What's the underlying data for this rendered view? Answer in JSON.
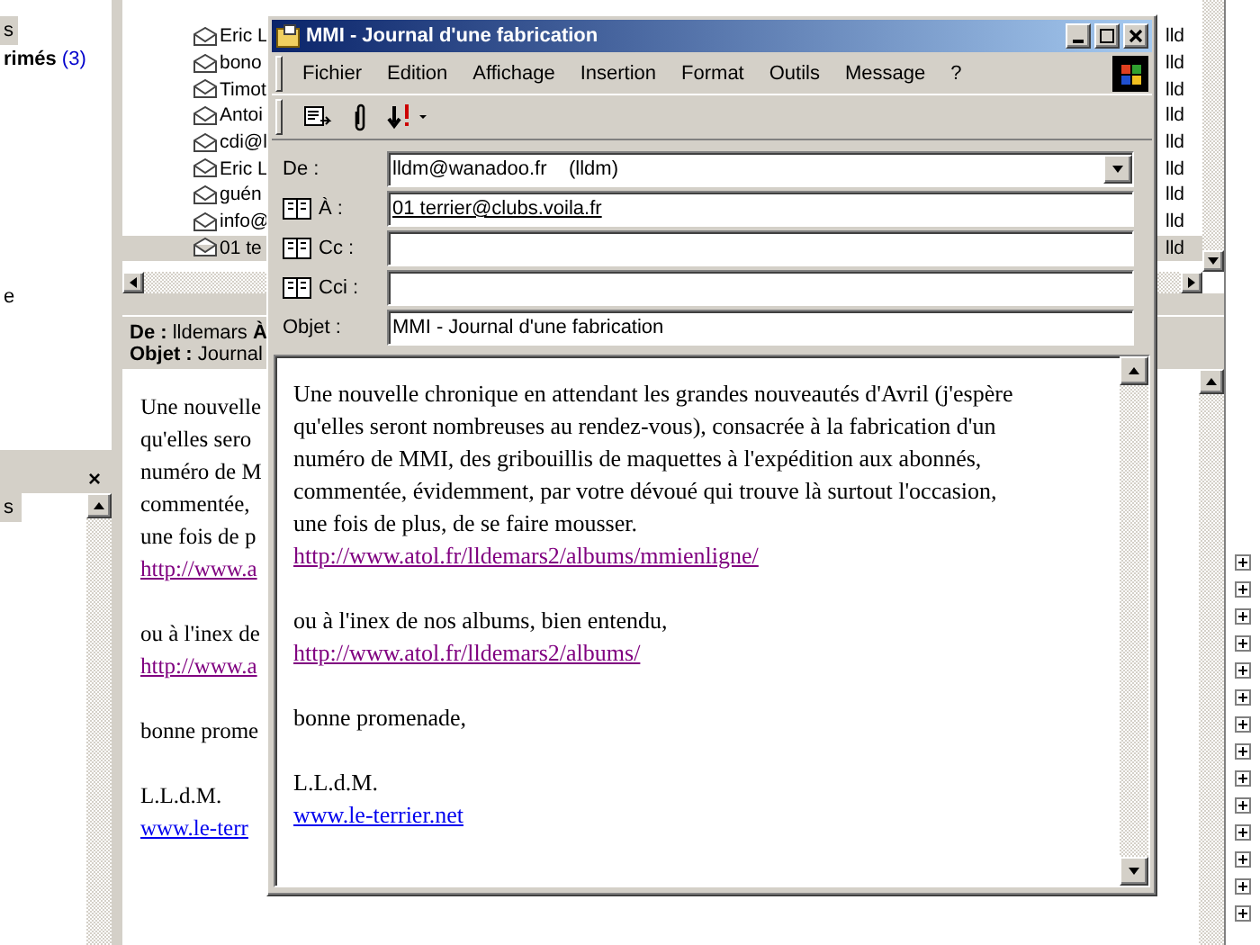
{
  "folder_pane": {
    "items": [
      {
        "label": "s",
        "selected": true
      },
      {
        "label": "rimés",
        "count": "(3)",
        "selected": false
      },
      {
        "label": "e",
        "selected": false
      }
    ]
  },
  "contacts_panel": {
    "close": "×",
    "items": [
      {
        "label": "s",
        "selected": true
      }
    ]
  },
  "message_list": {
    "rows": [
      {
        "sender": "Eric L",
        "account": "lld",
        "selected": false
      },
      {
        "sender": "bono",
        "account": "lld",
        "selected": false
      },
      {
        "sender": "Timot",
        "account": "lld",
        "selected": false
      },
      {
        "sender": "Antoi",
        "account": "lld",
        "selected": false
      },
      {
        "sender": "cdi@l",
        "account": "lld",
        "selected": false
      },
      {
        "sender": "Eric L",
        "account": "lld",
        "selected": false
      },
      {
        "sender": "guén",
        "account": "lld",
        "selected": false
      },
      {
        "sender": "info@",
        "account": "lld",
        "selected": false
      },
      {
        "sender": "01 te",
        "account": "lld",
        "selected": true
      }
    ]
  },
  "preview": {
    "header": [
      {
        "label": "De :",
        "value": "lldemars",
        "extra": "À"
      },
      {
        "label": "Objet :",
        "value": "Journal"
      }
    ],
    "body": [
      {
        "lines": [
          "Une nouvelle",
          "qu'elles sero",
          "numéro de M",
          "commentée,",
          "une fois de p"
        ],
        "link": {
          "text": "http://www.a",
          "visited": true
        }
      },
      {
        "lines": [
          "ou à l'inex de"
        ],
        "link": {
          "text": "http://www.a",
          "visited": true
        }
      },
      {
        "lines": [
          "bonne prome"
        ]
      },
      {
        "lines": [
          "L.L.d.M."
        ],
        "link": {
          "text": "www.le-terr",
          "visited": false
        }
      }
    ]
  },
  "folder_tree": {
    "nodes": [
      {
        "expanded": false
      },
      {
        "expanded": false
      },
      {
        "expanded": false
      },
      {
        "expanded": false
      },
      {
        "expanded": false
      },
      {
        "expanded": false
      },
      {
        "expanded": false
      },
      {
        "expanded": false
      },
      {
        "expanded": false
      },
      {
        "expanded": false
      },
      {
        "expanded": false
      },
      {
        "expanded": false
      },
      {
        "expanded": false
      },
      {
        "expanded": false
      }
    ]
  },
  "compose_window": {
    "title": "MMI - Journal d'une fabrication",
    "menu": [
      "Fichier",
      "Edition",
      "Affichage",
      "Insertion",
      "Format",
      "Outils",
      "Message",
      "?"
    ],
    "fields": [
      {
        "kind": "select",
        "label": "De :",
        "value": "lldm@wanadoo.fr    (lldm)"
      },
      {
        "kind": "recipient",
        "label": "À :",
        "value": "01 terrier@clubs.voila.fr"
      },
      {
        "kind": "recipient",
        "label": "Cc :"
      },
      {
        "kind": "recipient",
        "label": "Cci :"
      },
      {
        "kind": "text",
        "label": "Objet :",
        "value": "MMI - Journal d'une fabrication"
      }
    ],
    "body": [
      {
        "lines": [
          "Une nouvelle chronique en attendant les grandes nouveautés d'Avril (j'espère",
          "qu'elles seront nombreuses au rendez-vous), consacrée à la fabrication d'un",
          "numéro de MMI, des gribouillis de maquettes à l'expédition aux abonnés,",
          "commentée, évidemment, par votre dévoué qui trouve là surtout l'occasion,",
          "une fois de plus, de se faire mousser."
        ],
        "link": {
          "text": "http://www.atol.fr/lldemars2/albums/mmienligne/",
          "visited": true
        }
      },
      {
        "lines": [
          "ou à l'inex de nos albums, bien entendu,"
        ],
        "link": {
          "text": "http://www.atol.fr/lldemars2/albums/",
          "visited": true
        }
      },
      {
        "lines": [
          "bonne promenade,"
        ]
      },
      {
        "lines": [
          "L.L.d.M."
        ],
        "link": {
          "text": "www.le-terrier.net",
          "visited": false
        }
      }
    ]
  }
}
